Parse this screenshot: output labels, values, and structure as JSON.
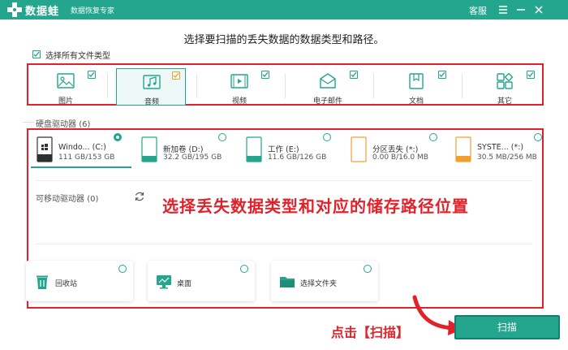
{
  "app": {
    "brand": "数据蛙",
    "subtitle": "数据恢复专家",
    "service": "客服",
    "accent": "#23a58e",
    "highlight": "#e0232b"
  },
  "heading": "选择要扫描的丢失数据的数据类型和路径。",
  "select_all": {
    "label": "选择所有文件类型",
    "checked": true
  },
  "file_types": [
    {
      "label": "图片",
      "icon": "image-icon",
      "checked": true,
      "selected": false
    },
    {
      "label": "音频",
      "icon": "audio-icon",
      "checked": true,
      "selected": true
    },
    {
      "label": "视频",
      "icon": "video-icon",
      "checked": true,
      "selected": false
    },
    {
      "label": "电子邮件",
      "icon": "email-icon",
      "checked": true,
      "selected": false
    },
    {
      "label": "文档",
      "icon": "document-icon",
      "checked": true,
      "selected": false
    },
    {
      "label": "其它",
      "icon": "other-icon",
      "checked": true,
      "selected": false
    }
  ],
  "hard_disk": {
    "label": "硬盘驱动器",
    "count": "(6)",
    "drives": [
      {
        "name": "Windo... (C:)",
        "size": "111 GB/153 GB",
        "icon": "windows-drive-icon",
        "selected": true
      },
      {
        "name": "新加卷 (D:)",
        "size": "32.2 GB/195 GB",
        "icon": "drive-icon",
        "selected": false
      },
      {
        "name": "工作 (E:)",
        "size": "11.6 GB/126 GB",
        "icon": "drive-icon",
        "selected": false
      },
      {
        "name": "分区丢失 (*:)",
        "size": "0.00  B/16.0 MB",
        "icon": "lost-partition-icon",
        "selected": false
      },
      {
        "name": "SYSTE... (*:)",
        "size": "30.5 MB/256 MB",
        "icon": "system-drive-icon",
        "selected": false
      }
    ]
  },
  "removable": {
    "label": "可移动驱动器",
    "count": "(0)"
  },
  "annotation": "选择丢失数据类型和对应的储存路径位置",
  "locations": [
    {
      "label": "回收站",
      "icon": "recycle-bin-icon"
    },
    {
      "label": "桌面",
      "icon": "desktop-icon"
    },
    {
      "label": "选择文件夹",
      "icon": "folder-icon"
    }
  ],
  "click_label": "点击【扫描】",
  "scan_button": "扫描"
}
